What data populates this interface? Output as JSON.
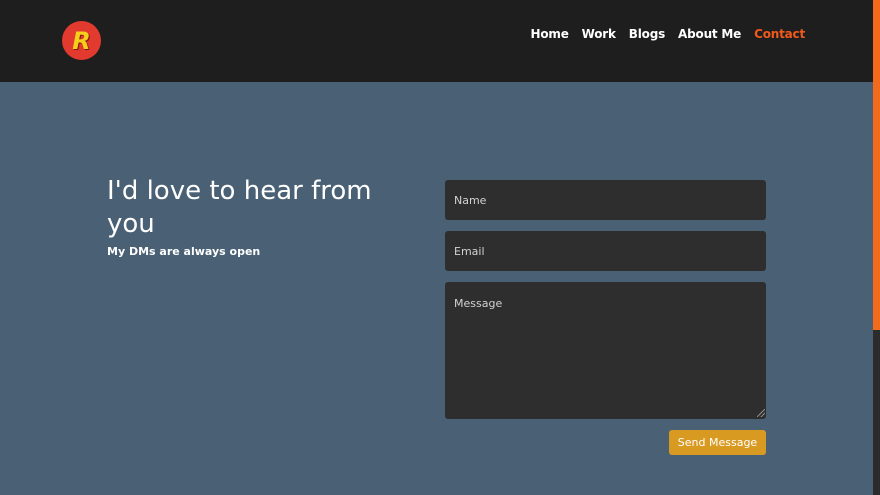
{
  "header": {
    "logo_letter": "R",
    "nav": [
      {
        "label": "Home"
      },
      {
        "label": "Work"
      },
      {
        "label": "Blogs"
      },
      {
        "label": "About Me"
      },
      {
        "label": "Contact",
        "active": true
      }
    ]
  },
  "intro": {
    "headline": "I'd love to hear from you",
    "subline": "My DMs are always open"
  },
  "form": {
    "name_placeholder": "Name",
    "email_placeholder": "Email",
    "message_placeholder": "Message",
    "send_label": "Send Message"
  },
  "colors": {
    "header_bg": "#1e1e1e",
    "page_bg": "#4a6075",
    "accent": "#f25a1c",
    "field_bg": "#2e2e2e",
    "button_bg": "#d99a22"
  }
}
